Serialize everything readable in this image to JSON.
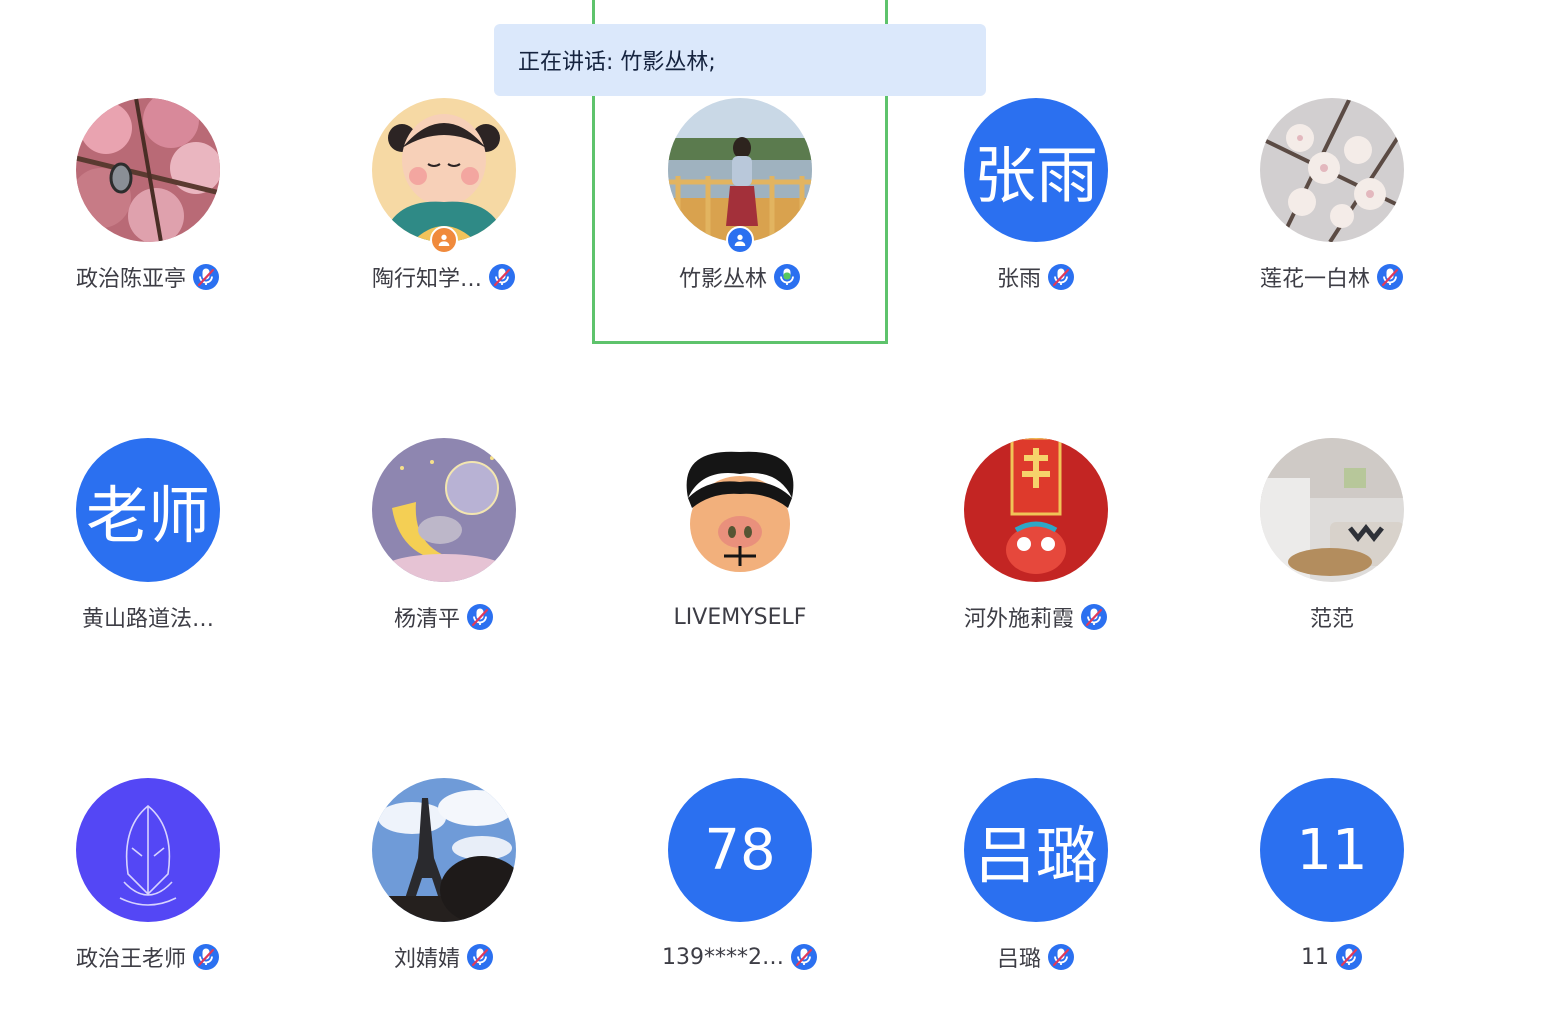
{
  "speaking_banner": {
    "label": "正在讲话: 竹影丛林;"
  },
  "participants": [
    {
      "name": "政治陈亚亭",
      "avatar": "photo-cherry-blossom",
      "mic": "muted-icon"
    },
    {
      "name": "陶行知学…",
      "avatar": "cartoon-girl",
      "mic": "muted-icon",
      "role": "host-icon"
    },
    {
      "name": "竹影丛林",
      "avatar": "photo-lakeside-woman",
      "mic": "speaking-icon",
      "role": "cohost-icon",
      "speaking": true
    },
    {
      "name": "张雨",
      "avatar_text": "张雨",
      "mic": "muted-icon"
    },
    {
      "name": "莲花一白林",
      "avatar": "photo-white-blossom",
      "mic": "muted-icon"
    },
    {
      "name": "黄山路道法…",
      "avatar_text": "老师"
    },
    {
      "name": "杨清平",
      "avatar": "cartoon-moon-kitten",
      "mic": "muted-icon"
    },
    {
      "name": "LIVEMYSELF",
      "avatar": "cartoon-pig-face"
    },
    {
      "name": "河外施莉霞",
      "avatar": "new-year-ox",
      "mic": "muted-icon"
    },
    {
      "name": "范范",
      "avatar": "photo-living-room"
    },
    {
      "name": "政治王老师",
      "avatar": "ultraman-line-art",
      "mic": "muted-icon"
    },
    {
      "name": "刘婧婧",
      "avatar": "photo-eiffel-tower",
      "mic": "muted-icon"
    },
    {
      "name": "139****2…",
      "avatar_text": "78",
      "mic": "muted-icon"
    },
    {
      "name": "吕璐",
      "avatar_text": "吕璐",
      "mic": "muted-icon"
    },
    {
      "name": "11",
      "avatar_text": "11",
      "mic": "muted-icon"
    }
  ],
  "colors": {
    "accent": "#2b70f0",
    "speaking_frame": "#5ec36c",
    "banner_bg": "#dbe8fb",
    "host_badge": "#f08a3c"
  }
}
